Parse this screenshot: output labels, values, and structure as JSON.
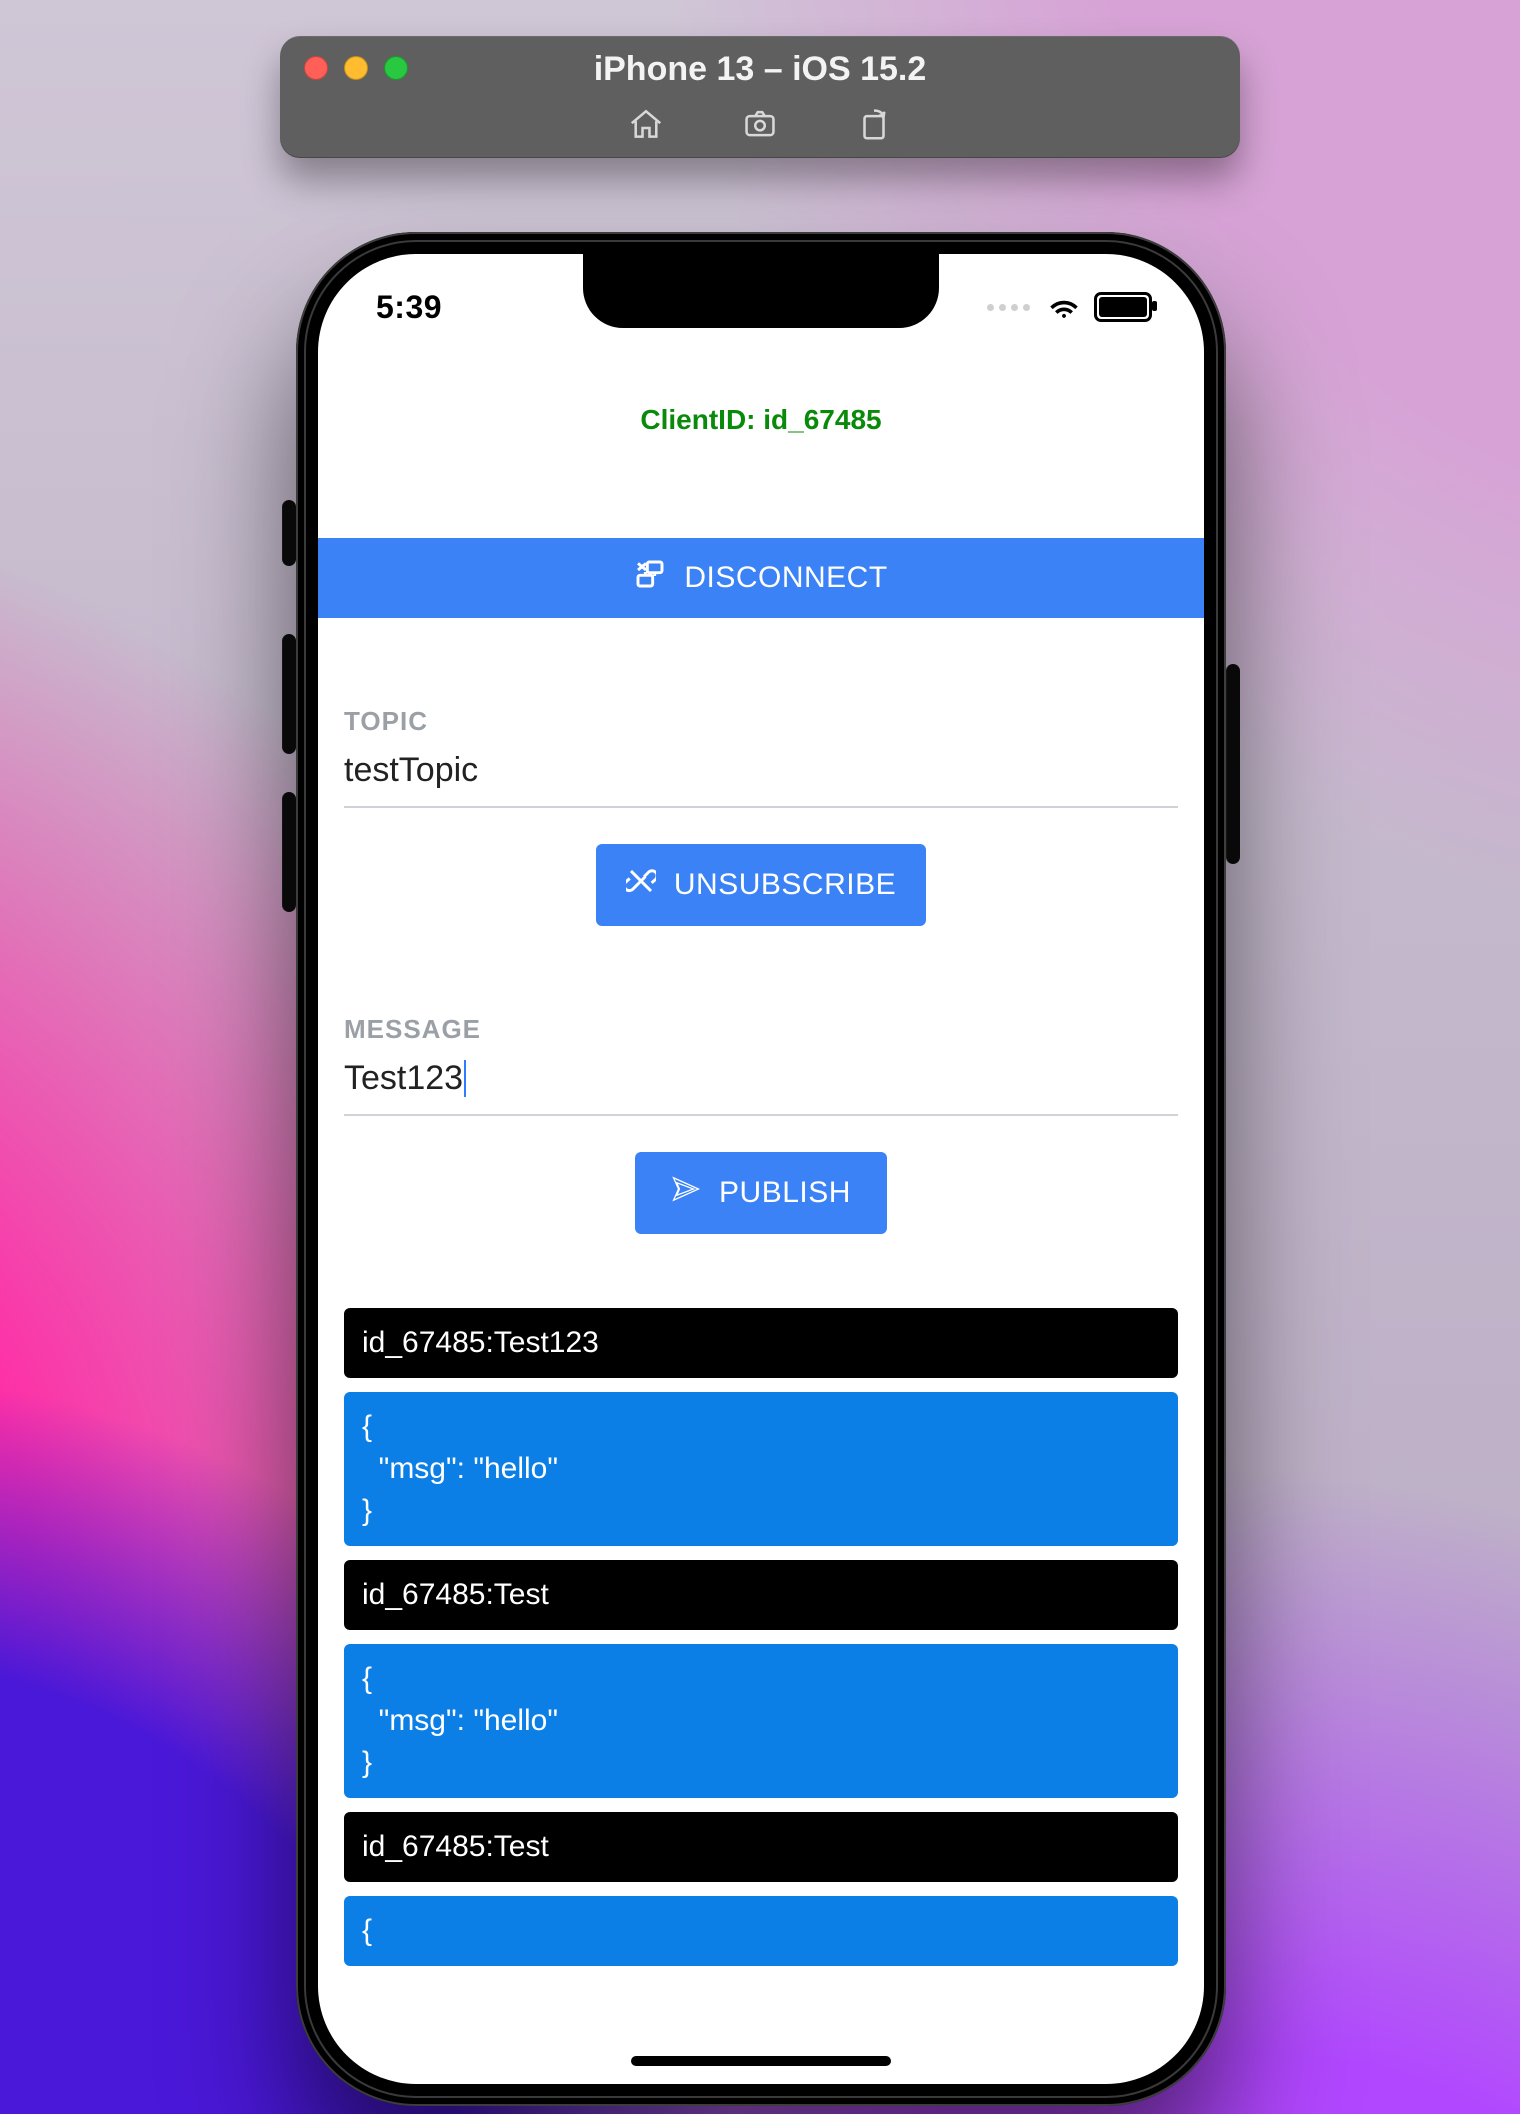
{
  "simulator": {
    "title": "iPhone 13 – iOS 15.2"
  },
  "status": {
    "time": "5:39"
  },
  "app": {
    "client_label": "ClientID: id_67485",
    "disconnect_label": "DISCONNECT",
    "topic_label": "TOPIC",
    "topic_value": "testTopic",
    "unsubscribe_label": "UNSUBSCRIBE",
    "message_label": "MESSAGE",
    "message_value": "Test123",
    "publish_label": "PUBLISH"
  },
  "messages": [
    {
      "type": "self",
      "text": "id_67485:Test123"
    },
    {
      "type": "in",
      "text": "{\n  \"msg\": \"hello\"\n}"
    },
    {
      "type": "self",
      "text": "id_67485:Test"
    },
    {
      "type": "in",
      "text": "{\n  \"msg\": \"hello\"\n}"
    },
    {
      "type": "self",
      "text": "id_67485:Test"
    }
  ]
}
